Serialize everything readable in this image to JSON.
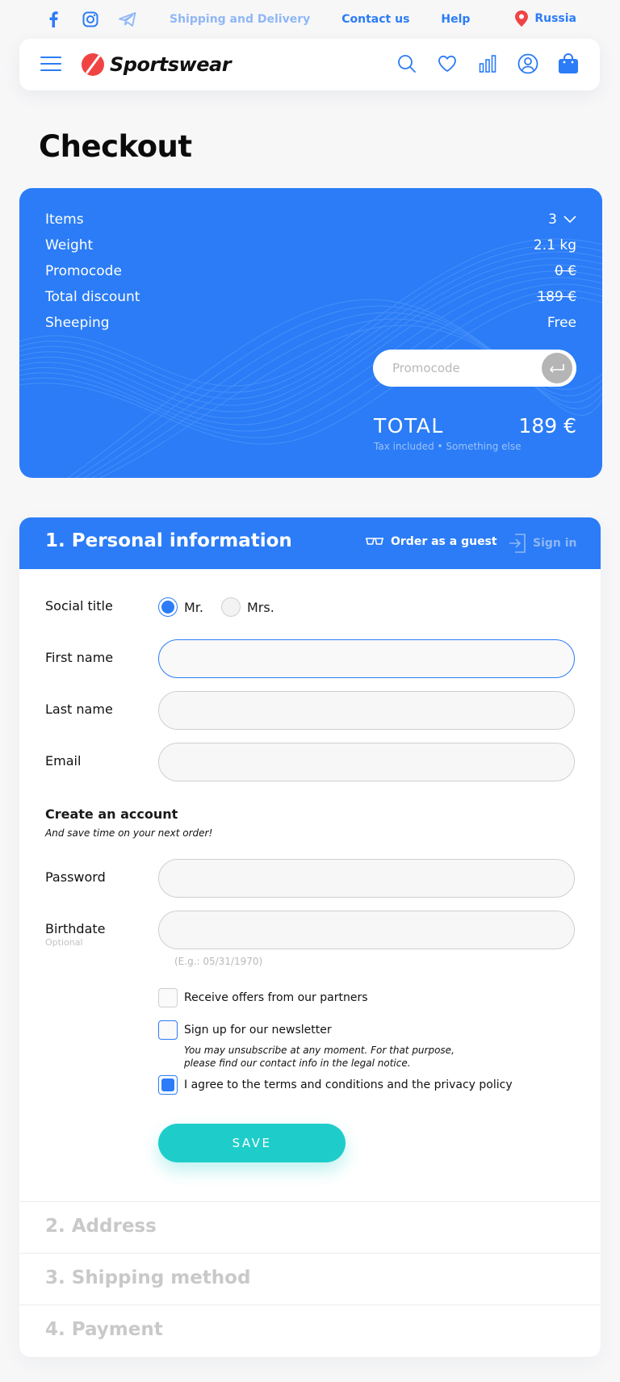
{
  "topbar": {
    "social": [
      "facebook-icon",
      "instagram-icon",
      "telegram-icon"
    ],
    "links": [
      {
        "label": "Shipping and Delivery",
        "muted": true
      },
      {
        "label": "Contact us",
        "muted": false
      },
      {
        "label": "Help",
        "muted": false
      }
    ],
    "region": "Russia"
  },
  "navbar": {
    "brand": "Sportswear",
    "icons": [
      "search-icon",
      "heart-icon",
      "chart-icon",
      "user-icon",
      "bag-icon"
    ]
  },
  "page": {
    "title": "Checkout"
  },
  "summary": {
    "rows": [
      {
        "label": "Items",
        "value": "3"
      },
      {
        "label": "Weight",
        "value": "2.1 kg"
      },
      {
        "label": "Promocode",
        "value": "0 €"
      },
      {
        "label": "Total discount",
        "value": "189 €"
      },
      {
        "label": "Sheeping",
        "value": "Free"
      }
    ],
    "promo_placeholder": "Promocode",
    "total_label": "TOTAL",
    "total_value": "189 €",
    "total_note": "Tax included • Something else"
  },
  "personal": {
    "title": "1. Personal information",
    "guest_label": "Order as a guest",
    "signin_label": "Sign in",
    "social_title_label": "Social title",
    "options": [
      "Mr.",
      "Mrs."
    ],
    "selected": "Mr.",
    "first_name_label": "First name",
    "first_name_value": "",
    "last_name_label": "Last name",
    "last_name_value": "",
    "email_label": "Email",
    "email_value": "",
    "account_title": "Create an account",
    "account_subtitle": "And save time on your next order!",
    "password_label": "Password",
    "password_value": "",
    "birthdate_label": "Birthdate",
    "birthdate_optional": "Optional",
    "birthdate_value": "",
    "birthdate_hint": "(E.g.: 05/31/1970)",
    "check_partners": "Receive offers from our partners",
    "check_newsletter": "Sign up for our newsletter",
    "newsletter_note": "You may unsubscribe at any moment. For that purpose, please find our contact info in the legal notice.",
    "check_terms": "I agree to the terms and conditions and the privacy policy",
    "terms_checked": true,
    "save_label": "SAVE"
  },
  "steps": [
    "2. Address",
    "3. Shipping method",
    "4. Payment"
  ],
  "colors": {
    "primary": "#2b7cf6",
    "accent": "#1ecdca",
    "brand_red": "#f04444"
  }
}
